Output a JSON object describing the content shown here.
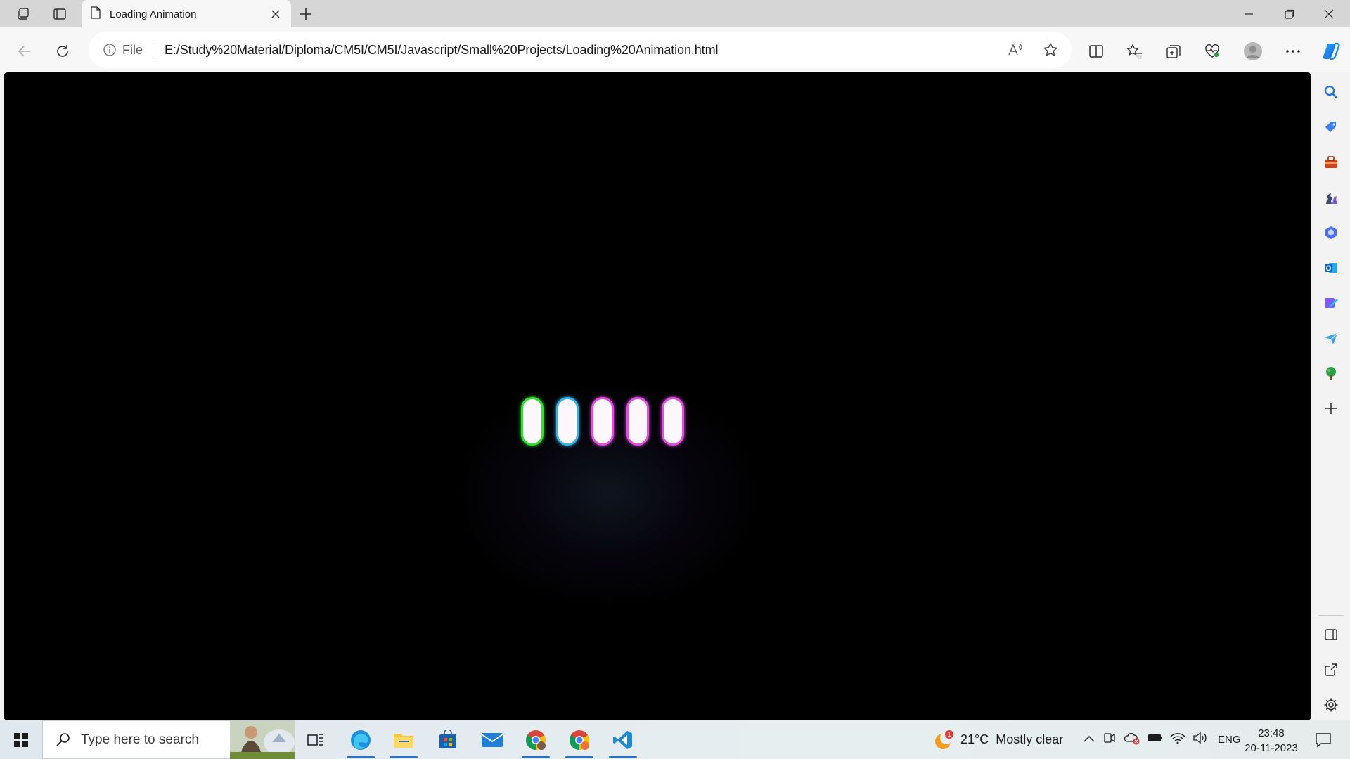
{
  "browser": {
    "tab": {
      "title": "Loading Animation"
    },
    "address": {
      "info_label": "File",
      "url": "E:/Study%20Material/Diploma/CM5I/CM5I/Javascript/Small%20Projects/Loading%20Animation.html"
    }
  },
  "page": {
    "loader_bars": [
      {
        "color": "#2fe02f"
      },
      {
        "color": "#36b4ea"
      },
      {
        "color": "#e04fe0"
      },
      {
        "color": "#e04fe0"
      },
      {
        "color": "#e04fe0"
      }
    ]
  },
  "taskbar": {
    "search_placeholder": "Type here to search",
    "weather": {
      "temperature": "21°C",
      "condition": "Mostly clear",
      "badge": "1"
    },
    "language": "ENG",
    "time": "23:48",
    "date": "20-11-2023"
  },
  "colors": {
    "accent": "#2f6fc4",
    "page_background": "#000000"
  }
}
